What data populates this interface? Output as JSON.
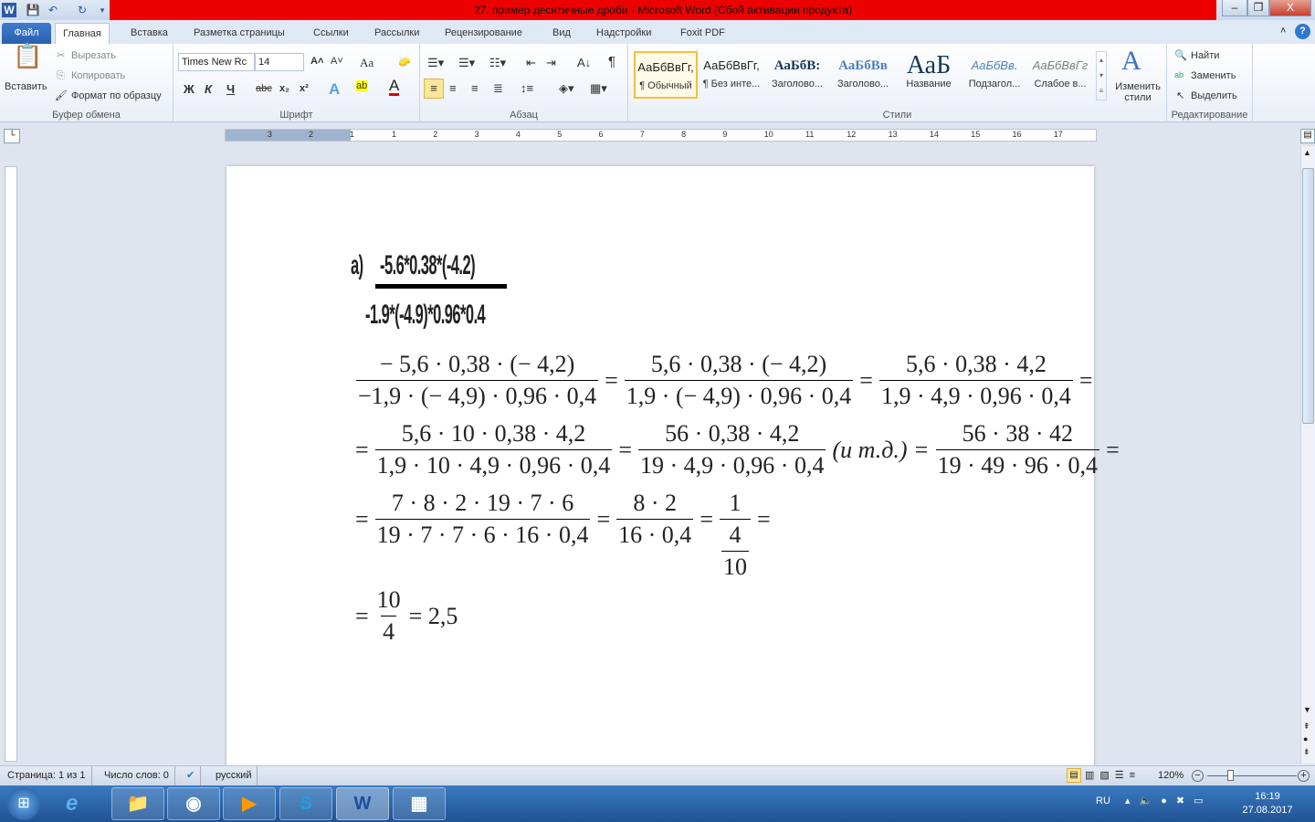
{
  "window": {
    "title": "27. пример десятичные дроби  -  Microsoft Word (Сбой активации продукта)",
    "app_icon": "W",
    "minimize": "–",
    "restore": "❐",
    "close": "X"
  },
  "tabs": [
    "Файл",
    "Главная",
    "Вставка",
    "Разметка страницы",
    "Ссылки",
    "Рассылки",
    "Рецензирование",
    "Вид",
    "Надстройки",
    "Foxit PDF"
  ],
  "ribbon": {
    "clipboard": {
      "paste": "Вставить",
      "cut": "Вырезать",
      "copy": "Копировать",
      "format_painter": "Формат по образцу",
      "label": "Буфер обмена"
    },
    "font": {
      "name": "Times New Rc",
      "size": "14",
      "bold": "Ж",
      "italic": "К",
      "underline": "Ч",
      "strike": "abc",
      "sub": "x₂",
      "sup": "x²",
      "case": "Aa",
      "grow": "A˄",
      "shrink": "A˅",
      "label": "Шрифт"
    },
    "paragraph": {
      "label": "Абзац",
      "pilcrow": "¶"
    },
    "styles": {
      "items": [
        {
          "sample": "АаБбВвГг,",
          "label": "¶ Обычный"
        },
        {
          "sample": "АаБбВвГг,",
          "label": "¶ Без инте..."
        },
        {
          "sample": "АаБбВ:",
          "label": "Заголово..."
        },
        {
          "sample": "АаБбВв",
          "label": "Заголово..."
        },
        {
          "sample": "АаБ",
          "label": "Название"
        },
        {
          "sample": "АаБбВв.",
          "label": "Подзагол..."
        },
        {
          "sample": "АаБбВвГг",
          "label": "Слабое в..."
        }
      ],
      "change": "Изменить стили",
      "label": "Стили"
    },
    "editing": {
      "find": "Найти",
      "replace": "Заменить",
      "select": "Выделить",
      "label": "Редактирование"
    }
  },
  "ruler": {
    "numbers": [
      "3",
      "2",
      "1",
      "1",
      "2",
      "3",
      "4",
      "5",
      "6",
      "7",
      "8",
      "9",
      "10",
      "11",
      "12",
      "13",
      "14",
      "15",
      "16",
      "17"
    ]
  },
  "document": {
    "heading_label": "а)",
    "heading_numerator": "-5.6*0.38*(-4.2)",
    "heading_denominator": "-1.9*(-4.9)*0.96*0.4",
    "equations": [
      [
        {
          "t": "frac",
          "num": "− 5,6 · 0,38 · (− 4,2)",
          "den": "−1,9 · (− 4,9) · 0,96 · 0,4"
        },
        {
          "t": "op",
          "v": "="
        },
        {
          "t": "frac",
          "num": "5,6 · 0,38 · (− 4,2)",
          "den": "1,9 · (− 4,9) · 0,96 · 0,4"
        },
        {
          "t": "op",
          "v": "="
        },
        {
          "t": "frac",
          "num": "5,6 · 0,38 · 4,2",
          "den": "1,9 · 4,9 · 0,96 · 0,4"
        },
        {
          "t": "op",
          "v": "="
        }
      ],
      [
        {
          "t": "op",
          "v": "="
        },
        {
          "t": "frac",
          "num": "5,6 · 10 · 0,38 · 4,2",
          "den": "1,9 · 10 · 4,9 · 0,96 · 0,4"
        },
        {
          "t": "op",
          "v": "="
        },
        {
          "t": "frac",
          "num": "56 · 0,38 · 4,2",
          "den": "19 · 4,9 · 0,96 · 0,4"
        },
        {
          "t": "op",
          "v": "(и т.д.) ="
        },
        {
          "t": "frac",
          "num": "56 · 38 · 42",
          "den": "19 · 49 · 96 · 0,4"
        },
        {
          "t": "op",
          "v": "="
        }
      ],
      [
        {
          "t": "op",
          "v": "="
        },
        {
          "t": "frac",
          "num": "7 · 8 · 2 · 19 · 7 · 6",
          "den": "19 · 7 · 7 · 6 · 16 · 0,4"
        },
        {
          "t": "op",
          "v": "="
        },
        {
          "t": "frac",
          "num": "8 · 2",
          "den": "16 · 0,4"
        },
        {
          "t": "op",
          "v": "="
        },
        {
          "t": "cfrac",
          "num": "1",
          "dnum": "4",
          "dden": "10"
        },
        {
          "t": "op",
          "v": "="
        }
      ],
      [
        {
          "t": "op",
          "v": "="
        },
        {
          "t": "frac",
          "num": "10",
          "den": "4"
        },
        {
          "t": "op",
          "v": "= 2,5"
        }
      ]
    ]
  },
  "status": {
    "page": "Страница: 1 из 1",
    "words": "Число слов: 0",
    "language": "русский",
    "zoom": "120%",
    "zoom_level_percent": 120
  },
  "taskbar": {
    "lang": "RU",
    "time": "16:19",
    "date": "27.08.2017"
  }
}
